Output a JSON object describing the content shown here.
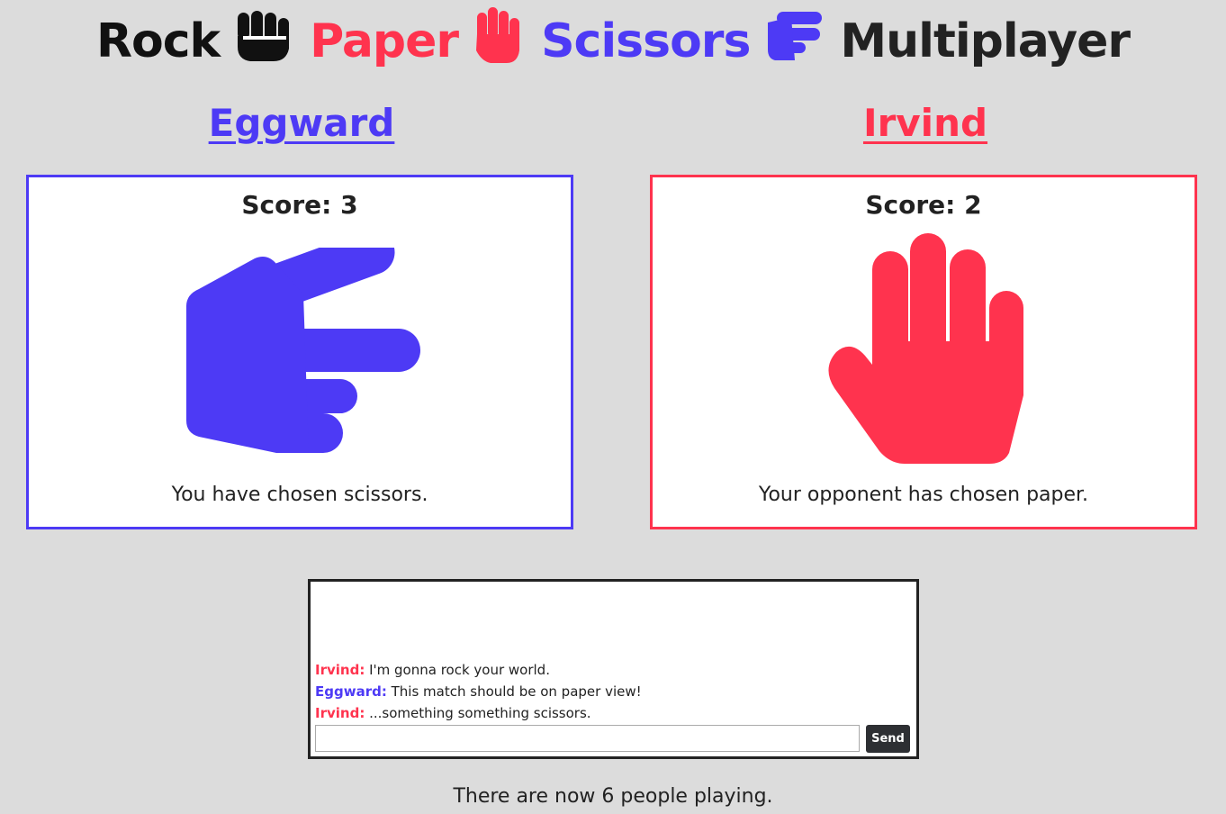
{
  "title": {
    "rock": "Rock",
    "paper": "Paper",
    "scissors": "Scissors",
    "multiplayer": "Multiplayer"
  },
  "players": [
    {
      "name": "Eggward",
      "score_text": "Score: 3",
      "choice": "scissors",
      "choice_text": "You have chosen scissors.",
      "color": "#4d3af5"
    },
    {
      "name": "Irvind",
      "score_text": "Score: 2",
      "choice": "paper",
      "choice_text": "Your opponent has chosen paper.",
      "color": "#ff334e"
    }
  ],
  "chat": {
    "messages": [
      {
        "author": "Irvind:",
        "text": "I'm gonna rock your world."
      },
      {
        "author": "Eggward:",
        "text": "This match should be on paper view!"
      },
      {
        "author": "Irvind:",
        "text": "...something something scissors."
      }
    ],
    "input_value": "",
    "send_label": "Send"
  },
  "status_text": "There are now 6 people playing.",
  "icons": {
    "rock": "fist-icon",
    "paper": "open-hand-icon",
    "scissors": "scissors-hand-icon"
  }
}
